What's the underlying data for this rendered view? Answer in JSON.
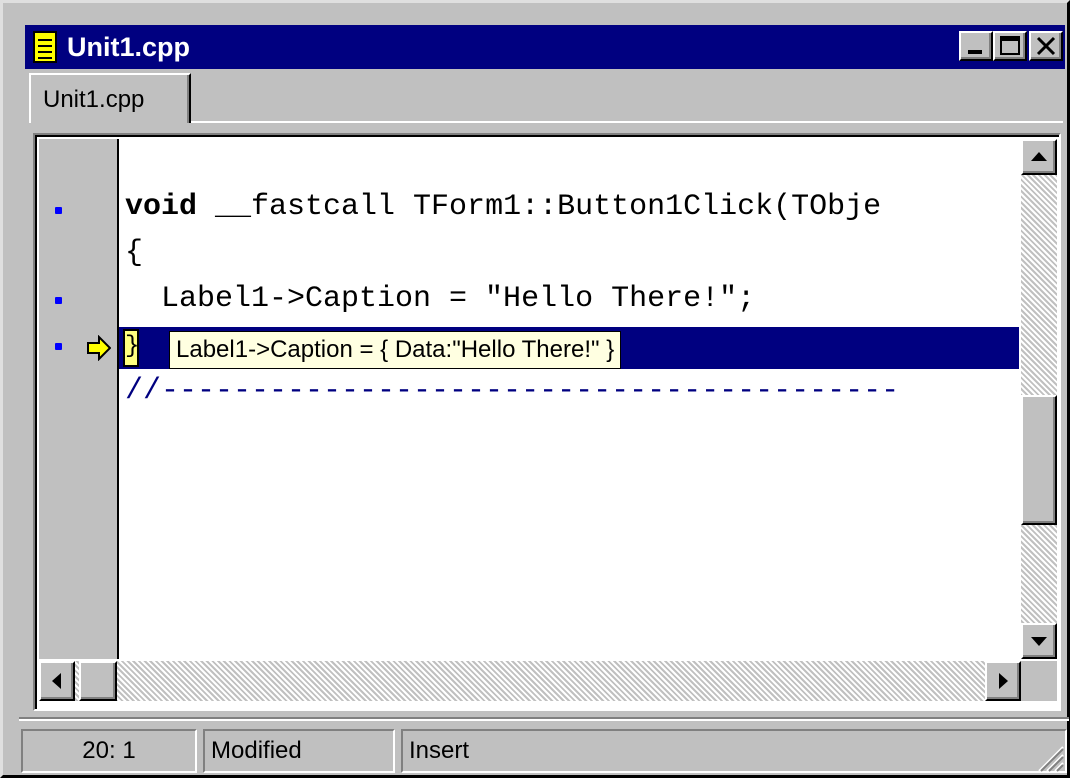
{
  "window": {
    "title": "Unit1.cpp",
    "icon": "document-icon",
    "controls": [
      "minimize-icon",
      "maximize-icon",
      "close-icon"
    ]
  },
  "tabs": [
    {
      "label": "Unit1.cpp",
      "active": true
    }
  ],
  "editor": {
    "lines": [
      {
        "kw": "void",
        "rest": " __fastcall TForm1::Button1Click(TObje",
        "has_breakpoint": true
      },
      {
        "text": "{",
        "has_breakpoint": false
      },
      {
        "text": "  Label1->Caption = \"Hello There!\";",
        "has_breakpoint": true
      },
      {
        "text": "}",
        "has_breakpoint": true,
        "is_execution_point": true
      },
      {
        "text": "//-----------------------------------------",
        "is_comment": true
      }
    ],
    "tooltip": "Label1->Caption = { Data:\"Hello There!\" }",
    "colors": {
      "highlight": "#000080",
      "comment": "#000080",
      "breakpoint_dot": "#0000ff",
      "tooltip_bg": "#ffffe1",
      "exec_arrow": "#ffff00"
    }
  },
  "status": {
    "position": "20:  1",
    "modified": "Modified",
    "mode": "Insert"
  }
}
